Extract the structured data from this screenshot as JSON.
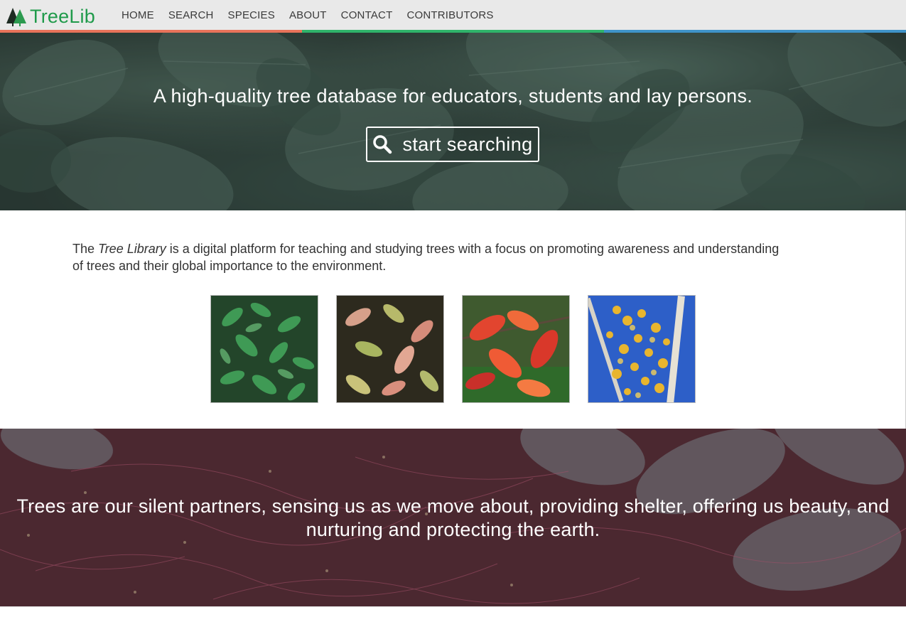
{
  "navbar": {
    "brand": "TreeLib",
    "links": [
      "HOME",
      "SEARCH",
      "SPECIES",
      "ABOUT",
      "CONTACT",
      "CONTRIBUTORS"
    ],
    "stripe_colors": [
      "#e8735a",
      "#2fb36a",
      "#3f93c9"
    ]
  },
  "hero": {
    "tagline": "A high-quality tree database for educators, students and lay persons.",
    "search_button": "start searching",
    "search_icon": "search-icon"
  },
  "about": {
    "text_prefix": "The ",
    "text_emphasis": "Tree Library",
    "text_suffix": " is a digital platform for teaching and studying trees with a focus on promoting awareness and understanding of trees and their global importance to the environment.",
    "thumbnails": [
      "green-leaves-image",
      "autumn-leaves-image",
      "red-leaves-image",
      "aspen-sky-image"
    ]
  },
  "quote": {
    "text": "Trees are our silent partners, sensing us as we move about, providing shelter, offering us beauty, and nurturing and protecting the earth."
  }
}
